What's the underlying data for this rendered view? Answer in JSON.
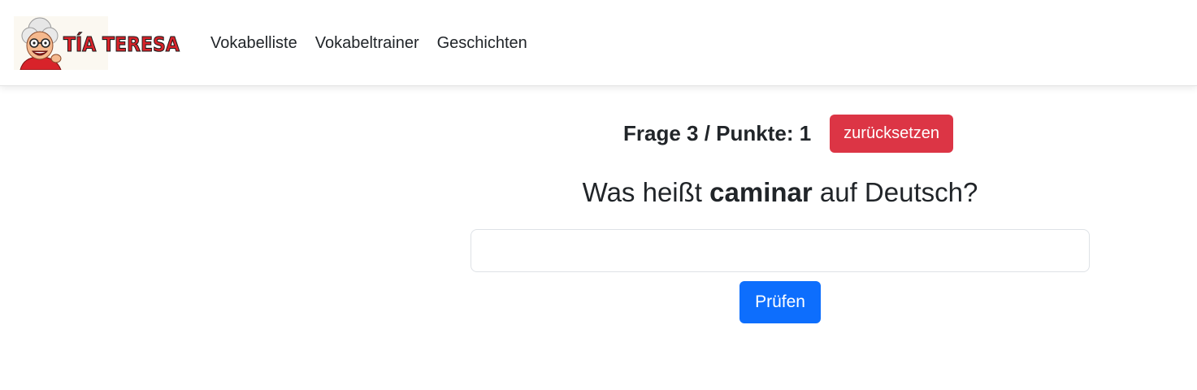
{
  "navbar": {
    "logo_text": "TÍA TERESA",
    "links": [
      {
        "label": "Vokabelliste"
      },
      {
        "label": "Vokabeltrainer"
      },
      {
        "label": "Geschichten"
      }
    ]
  },
  "quiz": {
    "status": "Frage 3 / Punkte: 1",
    "reset_label": "zurücksetzen",
    "question_prefix": "Was heißt ",
    "question_word": "caminar",
    "question_suffix": " auf Deutsch?",
    "answer_value": "",
    "answer_placeholder": "",
    "check_label": "Prüfen"
  },
  "colors": {
    "danger": "#dc3545",
    "primary": "#0d6efd",
    "logo_red": "#d8232a"
  }
}
